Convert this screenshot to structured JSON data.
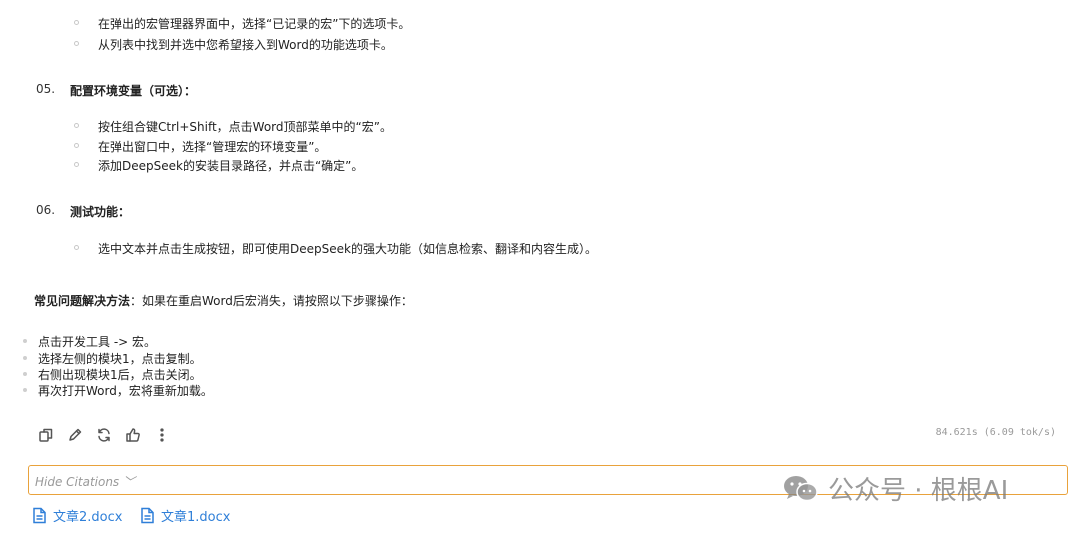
{
  "top_items": [
    "在弹出的宏管理器界面中，选择“已记录的宏”下的选项卡。",
    "从列表中找到并选中您希望接入到Word的功能选项卡。"
  ],
  "step05": {
    "number": "05.",
    "title": "配置环境变量（可选）：",
    "items": [
      "按住组合键Ctrl+Shift，点击Word顶部菜单中的“宏”。",
      "在弹出窗口中，选择“管理宏的环境变量”。",
      "添加DeepSeek的安装目录路径，并点击“确定”。"
    ]
  },
  "step06": {
    "number": "06.",
    "title": "测试功能：",
    "items": [
      "选中文本并点击生成按钮，即可使用DeepSeek的强大功能（如信息检索、翻译和内容生成）。"
    ]
  },
  "faq": {
    "label": "常见问题解决方法",
    "text": "：如果在重启Word后宏消失，请按照以下步骤操作："
  },
  "faq_items": [
    "点击开发工具 -> 宏。",
    "选择左侧的模块1，点击复制。",
    "右侧出现模块1后，点击关闭。",
    "再次打开Word，宏将重新加载。"
  ],
  "toolbar": {
    "icons": [
      "copy-icon",
      "edit-icon",
      "regenerate-icon",
      "thumbs-up-icon",
      "more-icon"
    ],
    "stats": "84.621s (6.09 tok/s)"
  },
  "citations": {
    "toggle_label": "Hide Citations ﹀",
    "files": [
      "文章2.docx",
      "文章1.docx"
    ]
  },
  "watermark": {
    "text": "公众号 · 根根AI",
    "icon": "wechat-icon"
  },
  "colors": {
    "accent_border": "#e9a23b",
    "link": "#2f7fd8"
  }
}
